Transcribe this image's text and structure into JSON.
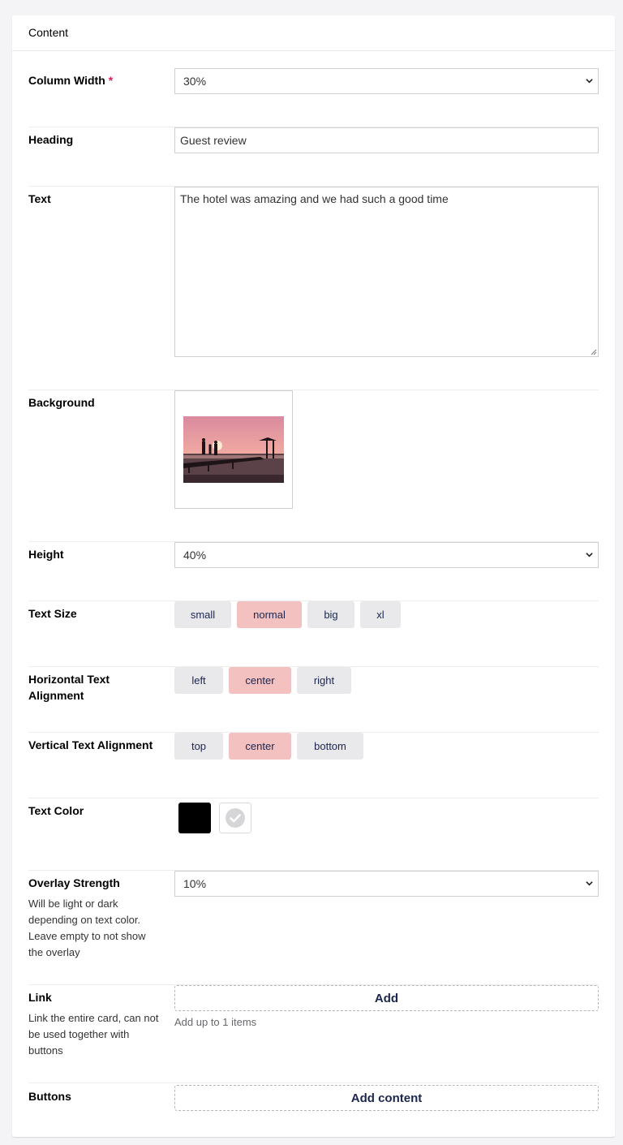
{
  "header": {
    "title": "Content"
  },
  "column_width": {
    "label": "Column Width",
    "required_mark": "*",
    "value": "30%"
  },
  "heading": {
    "label": "Heading",
    "value": "Guest review"
  },
  "text": {
    "label": "Text",
    "value": "The hotel was amazing and we had such a good time"
  },
  "background": {
    "label": "Background"
  },
  "height": {
    "label": "Height",
    "value": "40%"
  },
  "text_size": {
    "label": "Text Size",
    "options": [
      "small",
      "normal",
      "big",
      "xl"
    ],
    "selected": "normal"
  },
  "h_align": {
    "label": "Horizontal Text Alignment",
    "options": [
      "left",
      "center",
      "right"
    ],
    "selected": "center"
  },
  "v_align": {
    "label": "Vertical Text Alignment",
    "options": [
      "top",
      "center",
      "bottom"
    ],
    "selected": "center"
  },
  "text_color": {
    "label": "Text Color",
    "swatches": [
      "#000000",
      "#ffffff"
    ],
    "selected": "#ffffff"
  },
  "overlay": {
    "label": "Overlay Strength",
    "description": "Will be light or dark depending on text color. Leave empty to not show the overlay",
    "value": "10%"
  },
  "link": {
    "label": "Link",
    "description": "Link the entire card, can not be used together with buttons",
    "button": "Add",
    "hint": "Add up to 1 items"
  },
  "buttons": {
    "label": "Buttons",
    "button": "Add content"
  },
  "colors": {
    "active_option": "#f3c1c0",
    "inactive_option": "#e9e9eb",
    "text": "#1b264f"
  }
}
